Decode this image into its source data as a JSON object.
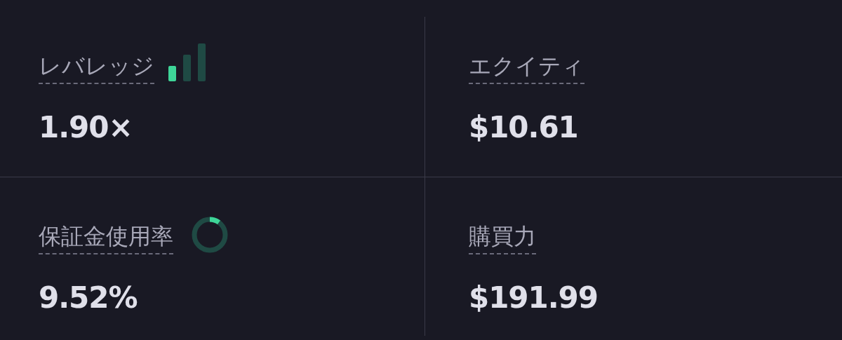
{
  "metrics": [
    {
      "label": "レバレッジ",
      "value": "1.90×",
      "indicator": {
        "kind": "bars",
        "level": 0.34
      }
    },
    {
      "label": "エクイティ",
      "value": "$10.61"
    },
    {
      "label": "保証金使用率",
      "value": "9.52%",
      "indicator": {
        "kind": "ring"
      }
    },
    {
      "label": "購買力",
      "value": "$191.99"
    }
  ]
}
